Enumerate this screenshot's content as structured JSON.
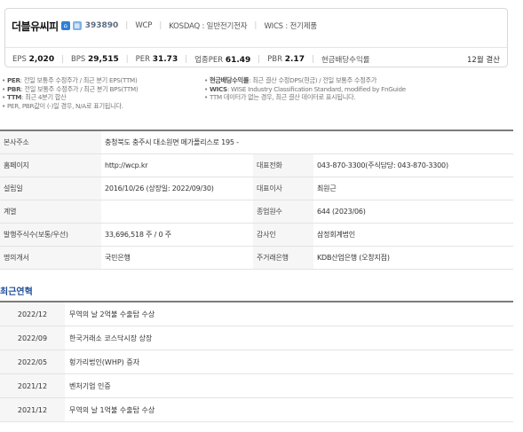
{
  "header": {
    "company_name": "더블유씨피",
    "icons": [
      "home-icon",
      "building-icon"
    ],
    "stock_code": "393890",
    "en_name": "WCP",
    "market": "KOSDAQ : 일반전기전자",
    "wics": "WICS : 전기제품"
  },
  "metrics": [
    {
      "label": "EPS",
      "value": "2,020"
    },
    {
      "label": "BPS",
      "value": "29,515"
    },
    {
      "label": "PER",
      "value": "31.73"
    },
    {
      "label": "업종PER",
      "value": "61.49"
    },
    {
      "label": "PBR",
      "value": "2.17"
    },
    {
      "label": "현금배당수익률",
      "value": ""
    }
  ],
  "metrics_right": "12월 결산",
  "notes_left": [
    {
      "key": "PER",
      "text": ": 전일 보통주 수정주가 / 최근 분기 EPS(TTM)"
    },
    {
      "key": "PBR",
      "text": ": 전일 보통주 수정주가 / 최근 분기 BPS(TTM)"
    },
    {
      "key": "TTM",
      "text": ": 최근 4분기 합산"
    },
    {
      "key": "",
      "text": "PER, PBR값이 (-)일 경우, N/A로 표기됩니다."
    }
  ],
  "notes_right": [
    {
      "key": "현금배당수익률",
      "text": ": 최근 결산 수정DPS(현금) / 전일 보통주 수정주가"
    },
    {
      "key": "WICS",
      "text": ": WISE Industry Classification Standard, modified by FnGuide"
    },
    {
      "key": "",
      "text": "TTM 데이터가 없는 경우, 최근 결산 데이터로 표시됩니다."
    }
  ],
  "info": {
    "address_label": "본사주소",
    "address": "충청북도 충주시 대소원면 메가폴리스로 195 -",
    "homepage_label": "홈페이지",
    "homepage": "http://wcp.kr",
    "phone_label": "대표전화",
    "phone": "043-870-3300(주식담당: 043-870-3300)",
    "founded_label": "설립일",
    "founded": "2016/10/26 (상장일: 2022/09/30)",
    "ceo_label": "대표이사",
    "ceo": "최원근",
    "group_label": "계열",
    "group": "",
    "employees_label": "종업원수",
    "employees": "644 (2023/06)",
    "shares_label": "발행주식수(보통/우선)",
    "shares": "33,696,518 주 / 0 주",
    "auditor_label": "감사인",
    "auditor": "삼정회계법인",
    "transfer_label": "명의개서",
    "transfer": "국민은행",
    "bank_label": "주거래은행",
    "bank": "KDB산업은행 (오창지점)"
  },
  "history_title": "최근연혁",
  "history": [
    {
      "date": "2022/12",
      "event": "무역의 날 2억불 수출탑 수상"
    },
    {
      "date": "2022/09",
      "event": "한국거래소 코스닥시장 상장"
    },
    {
      "date": "2022/05",
      "event": "헝가리법인(WHP) 증자"
    },
    {
      "date": "2021/12",
      "event": "벤처기업 인증"
    },
    {
      "date": "2021/12",
      "event": "무역의 날 1억불 수출탑 수상"
    }
  ]
}
